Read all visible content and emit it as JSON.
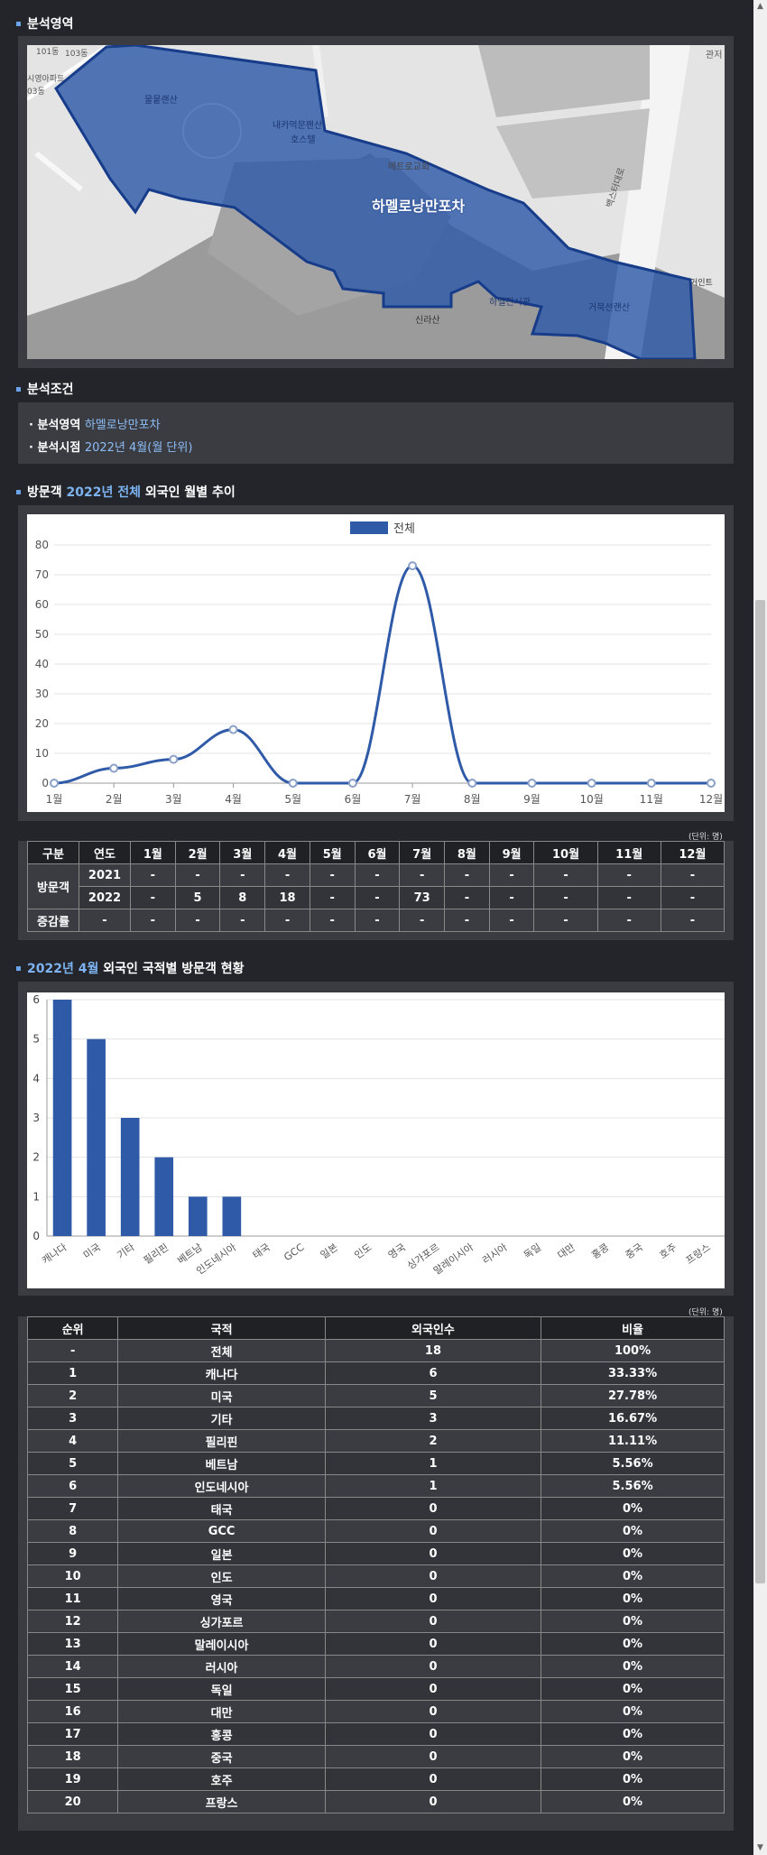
{
  "section1": {
    "title": "분석영역"
  },
  "map": {
    "area_label": "하멜로낭만포차",
    "labels": [
      "101동",
      "103동",
      "시영아파트",
      "03동",
      "물뭍랜산",
      "내카먹문팬산",
      "호스텔",
      "메트로교회",
      "하멜전시관",
      "거북선랜산",
      "신라산",
      "백스터대로",
      "관저",
      "거인트"
    ]
  },
  "section2": {
    "title": "분석조건"
  },
  "conditions": [
    {
      "key": "· 분석영역",
      "value": "하멜로낭만포차"
    },
    {
      "key": "· 분석시점",
      "value": "2022년 4월(월 단위)"
    }
  ],
  "section3": {
    "title_a": "방문객",
    "title_hl": "2022년 전체",
    "title_b": "외국인 월별 추이"
  },
  "chart_data": [
    {
      "type": "line",
      "legend": "전체",
      "categories": [
        "1월",
        "2월",
        "3월",
        "4월",
        "5월",
        "6월",
        "7월",
        "8월",
        "9월",
        "10월",
        "11월",
        "12월"
      ],
      "values": [
        0,
        5,
        8,
        18,
        0,
        0,
        73,
        0,
        0,
        0,
        0,
        0
      ],
      "ylim": [
        0,
        80
      ],
      "yticks": [
        0,
        10,
        20,
        30,
        40,
        50,
        60,
        70,
        80
      ],
      "color": "#2f5aa8"
    },
    {
      "type": "bar",
      "categories": [
        "캐나다",
        "미국",
        "기타",
        "필리핀",
        "베트남",
        "인도네시아",
        "태국",
        "GCC",
        "일본",
        "인도",
        "영국",
        "싱가포르",
        "말레이시아",
        "러시아",
        "독일",
        "대만",
        "홍콩",
        "중국",
        "호주",
        "프랑스"
      ],
      "values": [
        6,
        5,
        3,
        2,
        1,
        1,
        0,
        0,
        0,
        0,
        0,
        0,
        0,
        0,
        0,
        0,
        0,
        0,
        0,
        0
      ],
      "ylim": [
        0,
        6
      ],
      "yticks": [
        0,
        1,
        2,
        3,
        4,
        5,
        6
      ],
      "color": "#2f5aa8"
    }
  ],
  "unit_label": "(단위: 명)",
  "monthly_table": {
    "headers": [
      "구분",
      "연도",
      "1월",
      "2월",
      "3월",
      "4월",
      "5월",
      "6월",
      "7월",
      "8월",
      "9월",
      "10월",
      "11월",
      "12월"
    ],
    "visitor_label": "방문객",
    "rows": [
      [
        "2021",
        "-",
        "-",
        "-",
        "-",
        "-",
        "-",
        "-",
        "-",
        "-",
        "-",
        "-",
        "-"
      ],
      [
        "2022",
        "-",
        "5",
        "8",
        "18",
        "-",
        "-",
        "73",
        "-",
        "-",
        "-",
        "-",
        "-"
      ]
    ],
    "growth_label": "증감률",
    "growth": [
      "-",
      "-",
      "-",
      "-",
      "-",
      "-",
      "-",
      "-",
      "-",
      "-",
      "-",
      "-",
      "-"
    ]
  },
  "section4": {
    "title_hl": "2022년 4월",
    "title_b": "외국인 국적별 방문객 현황"
  },
  "rank_table": {
    "headers": [
      "순위",
      "국적",
      "외국인수",
      "비율"
    ],
    "rows": [
      [
        "-",
        "전체",
        "18",
        "100%"
      ],
      [
        "1",
        "캐나다",
        "6",
        "33.33%"
      ],
      [
        "2",
        "미국",
        "5",
        "27.78%"
      ],
      [
        "3",
        "기타",
        "3",
        "16.67%"
      ],
      [
        "4",
        "필리핀",
        "2",
        "11.11%"
      ],
      [
        "5",
        "베트남",
        "1",
        "5.56%"
      ],
      [
        "6",
        "인도네시아",
        "1",
        "5.56%"
      ],
      [
        "7",
        "태국",
        "0",
        "0%"
      ],
      [
        "8",
        "GCC",
        "0",
        "0%"
      ],
      [
        "9",
        "일본",
        "0",
        "0%"
      ],
      [
        "10",
        "인도",
        "0",
        "0%"
      ],
      [
        "11",
        "영국",
        "0",
        "0%"
      ],
      [
        "12",
        "싱가포르",
        "0",
        "0%"
      ],
      [
        "13",
        "말레이시아",
        "0",
        "0%"
      ],
      [
        "14",
        "러시아",
        "0",
        "0%"
      ],
      [
        "15",
        "독일",
        "0",
        "0%"
      ],
      [
        "16",
        "대만",
        "0",
        "0%"
      ],
      [
        "17",
        "홍콩",
        "0",
        "0%"
      ],
      [
        "18",
        "중국",
        "0",
        "0%"
      ],
      [
        "19",
        "호주",
        "0",
        "0%"
      ],
      [
        "20",
        "프랑스",
        "0",
        "0%"
      ]
    ]
  }
}
